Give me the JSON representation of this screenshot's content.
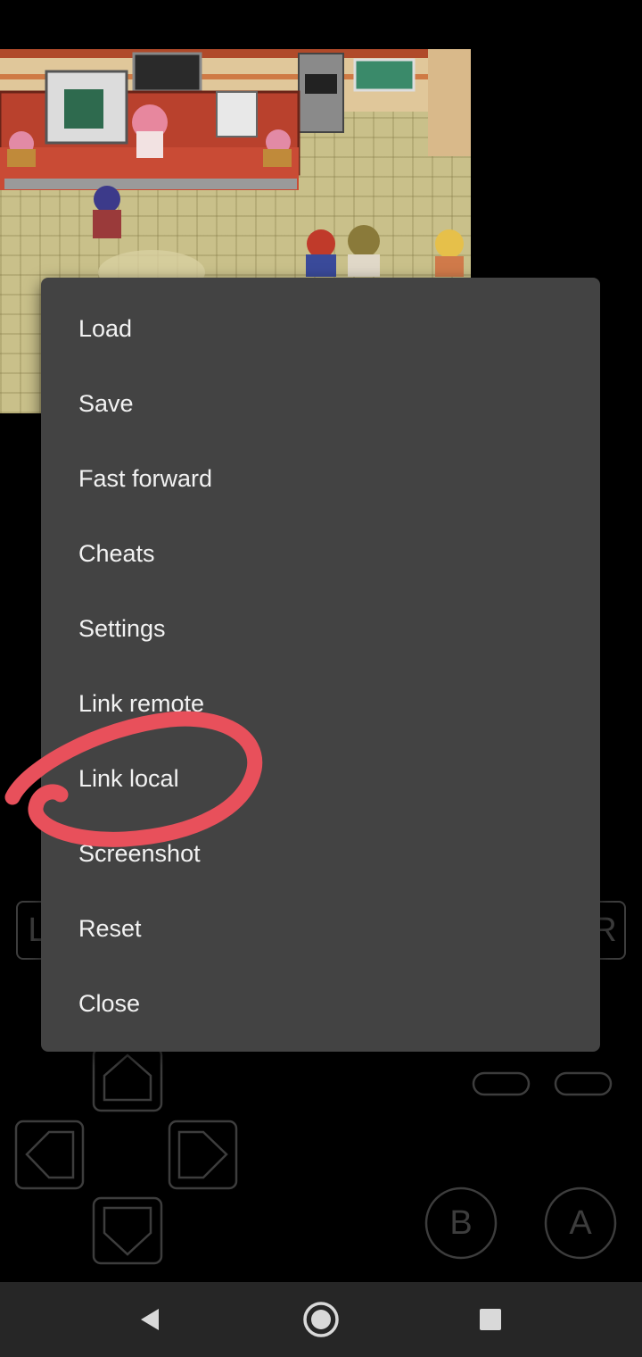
{
  "menu": {
    "items": [
      {
        "label": "Load"
      },
      {
        "label": "Save"
      },
      {
        "label": "Fast forward"
      },
      {
        "label": "Cheats"
      },
      {
        "label": "Settings"
      },
      {
        "label": "Link remote"
      },
      {
        "label": "Link local"
      },
      {
        "label": "Screenshot"
      },
      {
        "label": "Reset"
      },
      {
        "label": "Close"
      }
    ]
  },
  "controller": {
    "l_label": "L",
    "r_label": "R",
    "b_label": "B",
    "a_label": "A"
  },
  "annotation": {
    "circled_item": "Link local",
    "color": "#e8505b"
  },
  "navbar": {
    "back": "back-icon",
    "home": "home-icon",
    "recents": "recents-icon"
  }
}
